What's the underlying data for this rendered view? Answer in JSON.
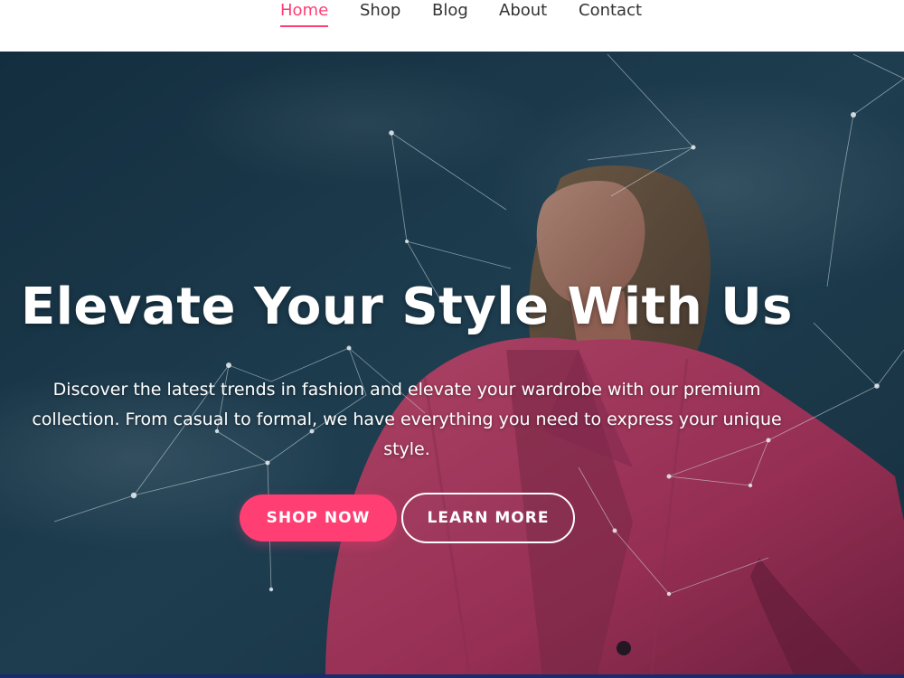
{
  "nav": {
    "items": [
      {
        "label": "Home",
        "active": true
      },
      {
        "label": "Shop",
        "active": false
      },
      {
        "label": "Blog",
        "active": false
      },
      {
        "label": "About",
        "active": false
      },
      {
        "label": "Contact",
        "active": false
      }
    ]
  },
  "hero": {
    "title": "Elevate Your Style With Us",
    "description_lines": [
      "Discover the latest trends in fashion and elevate your wardrobe with our premium",
      "collection. From casual to formal, we have everything you need to express your unique",
      "style."
    ],
    "buttons": {
      "shop_now": "SHOP NOW",
      "learn_more": "LEARN MORE"
    }
  },
  "colors": {
    "accent": "#ff3f74",
    "nav_text": "#333333",
    "hero_text": "#ffffff",
    "sky_dark": "#1c3a4c",
    "jacket": "#d0406a"
  },
  "decor": {
    "background_image": "woman-in-pink-jacket-against-sky",
    "overlay_effect": "particle-network"
  }
}
